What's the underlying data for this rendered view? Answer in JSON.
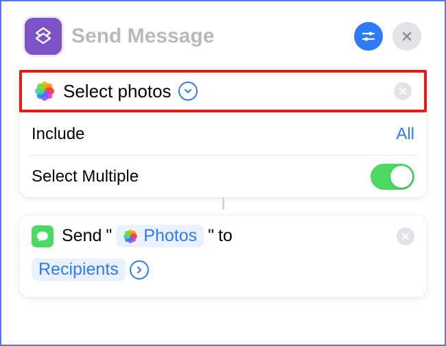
{
  "header": {
    "title": "Send Message"
  },
  "actions": {
    "select_photos": {
      "label": "Select photos"
    },
    "include": {
      "label": "Include",
      "value": "All"
    },
    "select_multiple": {
      "label": "Select Multiple",
      "enabled": true
    },
    "send": {
      "prefix": "Send",
      "open_quote": "\"",
      "variable_photos": "Photos",
      "close_quote": "\"",
      "to": "to",
      "recipients": "Recipients"
    }
  },
  "icons": {
    "app": "shortcuts-layers-icon",
    "settings": "sliders-icon",
    "close": "close-icon",
    "photos": "photos-flower-icon",
    "chevron_down": "chevron-down-icon",
    "remove": "remove-icon",
    "messages": "messages-icon",
    "arrow_right": "arrow-right-icon"
  },
  "colors": {
    "accent": "#2d7bf6",
    "app_purple": "#7c52c6",
    "toggle_green": "#4cd964",
    "highlight_border": "#e21b1b"
  }
}
